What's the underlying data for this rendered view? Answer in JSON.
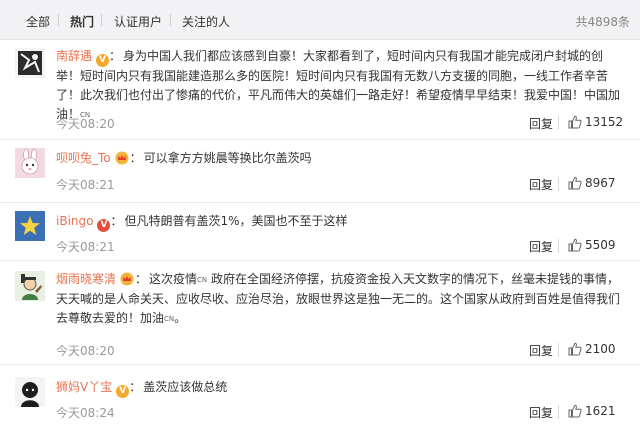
{
  "tabs": {
    "all": "全部",
    "hot": "热门",
    "verified": "认证用户",
    "following": "关注的人",
    "total": "共4898条"
  },
  "comments": [
    {
      "user": "南辞遇",
      "badge": "V",
      "text": "身为中国人我们都应该感到自豪！大家都看到了，短时间内只有我国才能完成闭户封城的创举！短时间内只有我国能建造那么多的医院！短时间内只有我国有无数八方支援的同胞，一线工作者辛苦了！此次我们也付出了惨痛的代价，平凡而伟大的英雄们一路走好！希望疫情早早结束！我爱中国！中国加油！",
      "text_suffix": "CN",
      "time": "今天08:20",
      "reply": "回复",
      "likes": "13152"
    },
    {
      "user": "呗呗兔_To",
      "text": "可以拿方方姚晨等换比尔盖茨吗",
      "time": "今天08:21",
      "reply": "回复",
      "likes": "8967"
    },
    {
      "user": "iBingo",
      "badge": "V",
      "text": "但凡特朗普有盖茨1%，美国也不至于这样",
      "time": "今天08:21",
      "reply": "回复",
      "likes": "5509"
    },
    {
      "user": "烟雨晓寒清",
      "text_pre": "这次疫情",
      "text_cn1": "CN",
      "text_mid": " 政府在全国经济停摆，抗疫资金投入天文数字的情况下，丝毫未提钱的事情，天天喊的是人命关天、应收尽收、应治尽治，放眼世界这是独一无二的。这个国家从政府到百姓是值得我们去尊敬去爱的！加油",
      "text_cn2": "CN",
      "text_end": "。",
      "time": "今天08:20",
      "reply": "回复",
      "likes": "2100"
    },
    {
      "user": "狮妈V丫宝",
      "badge": "V",
      "text": "盖茨应该做总统",
      "time": "今天08:24",
      "reply": "回复",
      "likes": "1621"
    }
  ],
  "colors": {
    "username": "#eb7350",
    "time": "#999999",
    "tabbar_bg": "#f2f2f5"
  }
}
